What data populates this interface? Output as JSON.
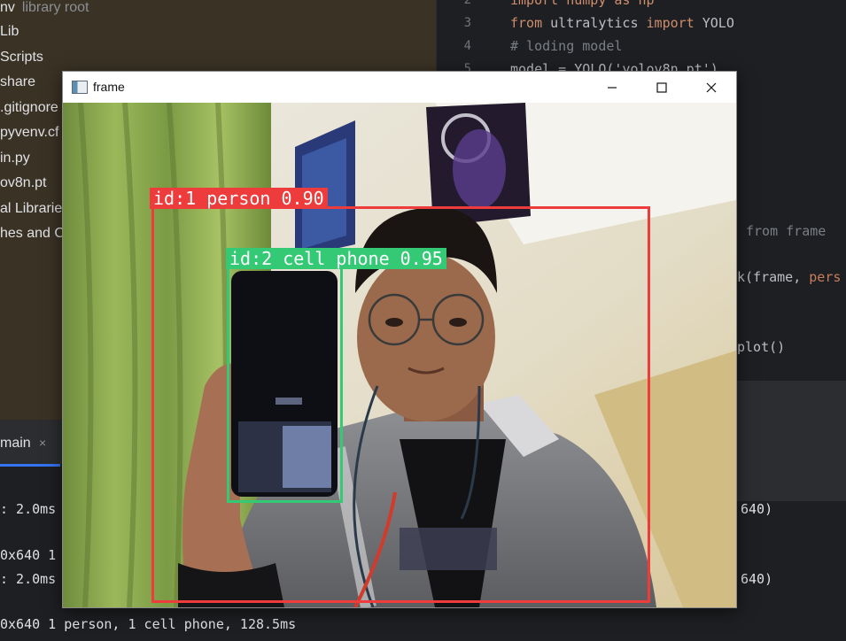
{
  "project_tree": {
    "items": [
      {
        "label": "nv",
        "muted": "library root"
      },
      {
        "label": "Lib"
      },
      {
        "label": "Scripts"
      },
      {
        "label": "share"
      },
      {
        "label": ".gitignore"
      },
      {
        "label": "pyvenv.cf"
      },
      {
        "label": "in.py"
      },
      {
        "label": "ov8n.pt"
      },
      {
        "label": "al Librarie"
      },
      {
        "label": "hes and C"
      }
    ]
  },
  "editor": {
    "line_numbers": [
      "2",
      "3",
      "4",
      "5"
    ],
    "lines": {
      "l1": "import numpy as np",
      "l2_kw1": "from",
      "l2_mod": " ultralytics ",
      "l2_kw2": "import",
      "l2_cls": " YOLO",
      "l3": "# loding model",
      "l4": "model = YOLO('yolov8n.pt')",
      "l5": "from frame",
      "l6_prefix": "k(frame, ",
      "l6_param": "pers",
      "l7": "plot()"
    }
  },
  "run_panel": {
    "tab_label": "main",
    "tab_close": "×",
    "console": [
      ": 2.0ms",
      "0x640 1",
      ": 2.0ms",
      "0x640 1 person, 1 cell phone, 128.5ms"
    ],
    "right_console": [
      "640)",
      "640)"
    ]
  },
  "frame_window": {
    "title": "frame",
    "minimize_icon": "minimize-icon",
    "maximize_icon": "maximize-icon",
    "close_icon": "close-icon",
    "detections": [
      {
        "label": "id:1 person 0.90",
        "color": "#ee3b3b"
      },
      {
        "label": "id:2 cell phone 0.95",
        "color": "#34c975"
      }
    ]
  }
}
